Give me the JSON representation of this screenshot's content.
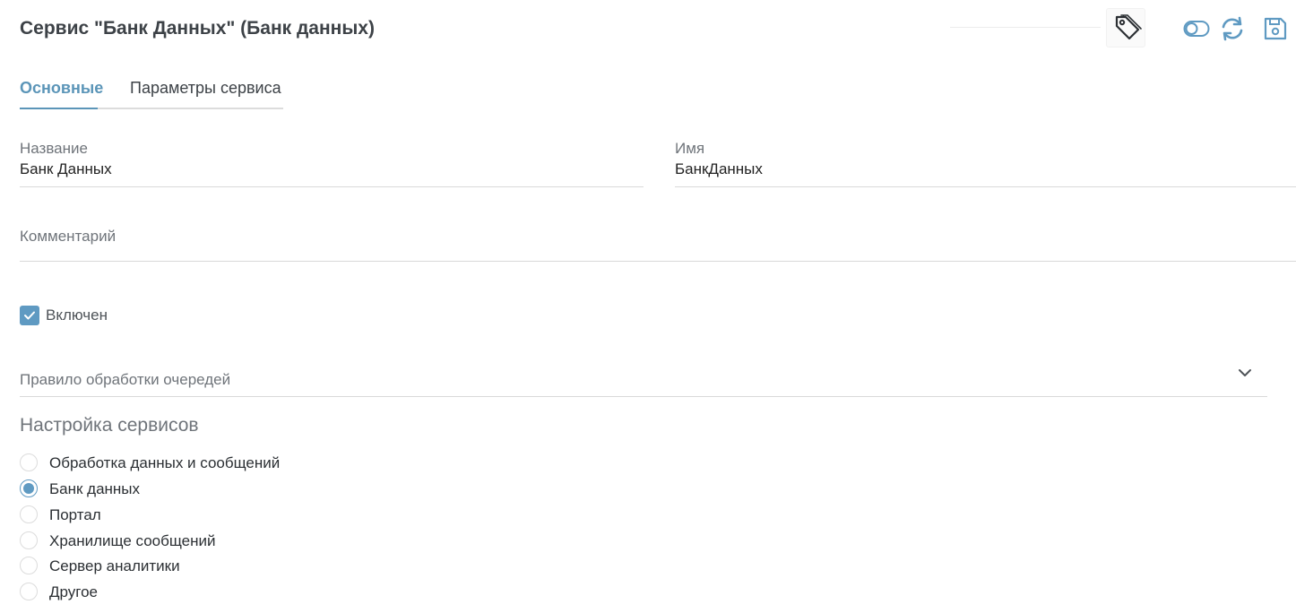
{
  "header": {
    "title": "Сервис \"Банк Данных\" (Банк данных)",
    "icons": [
      "tag-icon",
      "toggle-icon",
      "refresh-icon",
      "save-icon"
    ]
  },
  "tabs": [
    {
      "label": "Основные",
      "active": true
    },
    {
      "label": "Параметры сервиса",
      "active": false
    }
  ],
  "form": {
    "name": {
      "label": "Название",
      "value": "Банк Данных"
    },
    "id_name": {
      "label": "Имя",
      "value": "БанкДанных"
    },
    "comment": {
      "label": "Комментарий",
      "value": ""
    },
    "enabled": {
      "label": "Включен",
      "checked": true
    },
    "queue_rule": {
      "label": "Правило обработки очередей",
      "value": ""
    }
  },
  "services_section": {
    "title": "Настройка сервисов",
    "options": [
      {
        "label": "Обработка данных и сообщений",
        "selected": false
      },
      {
        "label": "Банк данных",
        "selected": true
      },
      {
        "label": "Портал",
        "selected": false
      },
      {
        "label": "Хранилище сообщений",
        "selected": false
      },
      {
        "label": "Сервер аналитики",
        "selected": false
      },
      {
        "label": "Другое",
        "selected": false
      }
    ]
  },
  "colors": {
    "accent": "#5f9ac2",
    "title_text": "#3d4247",
    "label_text": "#6f747a",
    "divider": "#d9d9d9"
  }
}
